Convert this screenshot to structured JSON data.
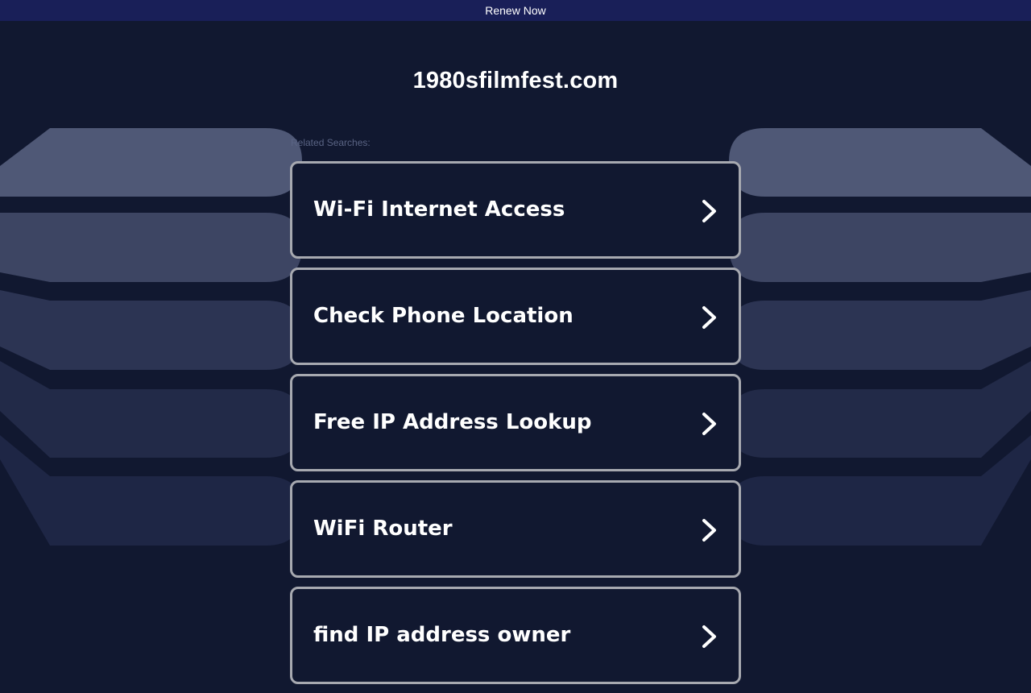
{
  "banner": {
    "renew_label": "Renew Now"
  },
  "header": {
    "domain": "1980sfilmfest.com"
  },
  "related": {
    "label": "Related Searches:",
    "items": [
      {
        "label": "Wi-Fi Internet Access",
        "icon": "chevron-right-icon"
      },
      {
        "label": "Check Phone Location",
        "icon": "chevron-right-icon"
      },
      {
        "label": "Free IP Address Lookup",
        "icon": "chevron-right-icon"
      },
      {
        "label": "WiFi Router",
        "icon": "chevron-right-icon"
      },
      {
        "label": "find IP address owner",
        "icon": "chevron-right-icon"
      }
    ]
  },
  "colors": {
    "background": "#111830",
    "banner": "#191f58",
    "card_border": "#a7a9b0",
    "text": "#ffffff"
  }
}
